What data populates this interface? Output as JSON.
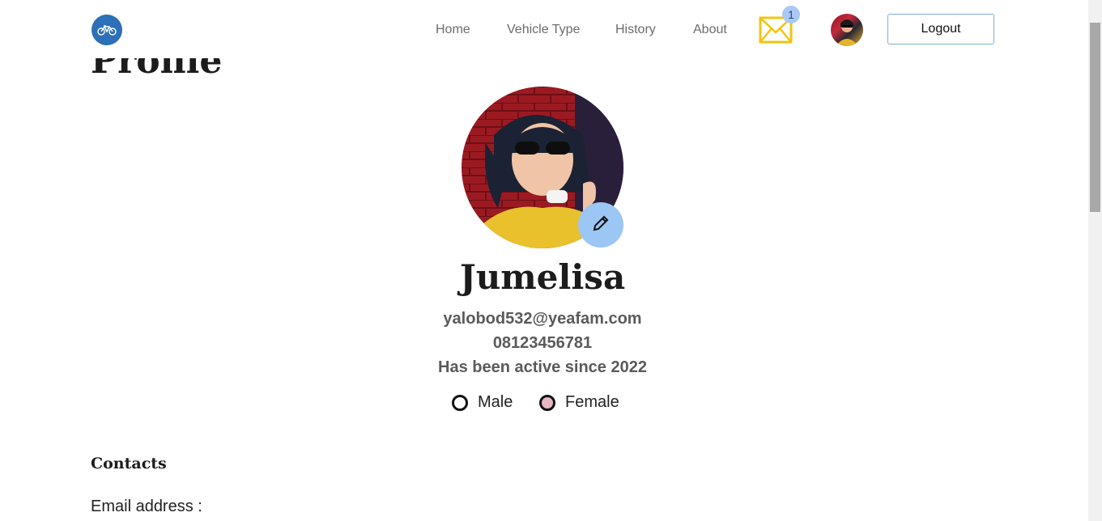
{
  "page": {
    "title": "Profile"
  },
  "navbar": {
    "links": [
      "Home",
      "Vehicle Type",
      "History",
      "About"
    ],
    "notification_count": "1",
    "logout_label": "Logout"
  },
  "profile": {
    "name": "Jumelisa",
    "email": "yalobod532@yeafam.com",
    "phone": "08123456781",
    "active_since": "Has been active since 2022",
    "gender_options": [
      "Male",
      "Female"
    ],
    "selected_gender": "Female"
  },
  "contacts": {
    "title": "Contacts",
    "email_label": "Email address :"
  },
  "colors": {
    "accent": "#9cc6f3",
    "logout_border": "#7db0cf",
    "mail_icon": "#f2c40f",
    "selected_radio": "#e6b6c3"
  },
  "icons": [
    "bicycle-logo-icon",
    "mail-icon",
    "pencil-icon"
  ]
}
